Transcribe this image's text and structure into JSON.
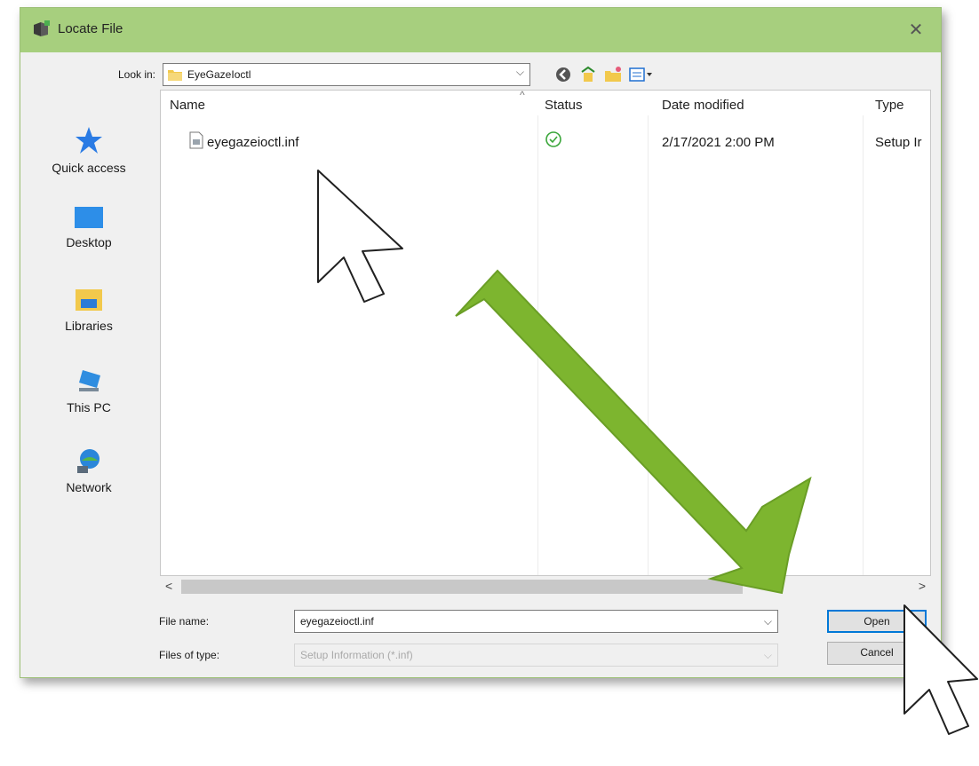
{
  "window": {
    "title": "Locate File",
    "close_glyph": "✕"
  },
  "look_in": {
    "label": "Look in:",
    "value": "EyeGazeIoctl"
  },
  "toolbar": {
    "icons": [
      "back-icon",
      "up-folder-icon",
      "new-folder-icon",
      "view-menu-icon"
    ]
  },
  "places": [
    {
      "label": "Quick access",
      "icon": "quick-access-icon"
    },
    {
      "label": "Desktop",
      "icon": "desktop-icon"
    },
    {
      "label": "Libraries",
      "icon": "libraries-icon"
    },
    {
      "label": "This PC",
      "icon": "this-pc-icon"
    },
    {
      "label": "Network",
      "icon": "network-icon"
    }
  ],
  "file_list": {
    "columns": [
      "Name",
      "Status",
      "Date modified",
      "Type"
    ],
    "sort_glyph": "^",
    "rows": [
      {
        "name": "eyegazeioctl.inf",
        "status": "synced",
        "date": "2/17/2021 2:00 PM",
        "type": "Setup Ir"
      }
    ]
  },
  "scrollbar": {
    "left_glyph": "<",
    "right_glyph": ">"
  },
  "file_name": {
    "label": "File name:",
    "value": "eyegazeioctl.inf"
  },
  "file_type": {
    "label": "Files of type:",
    "value": "Setup Information (*.inf)"
  },
  "buttons": {
    "open": "Open",
    "cancel": "Cancel"
  },
  "colors": {
    "titlebar": "#a7cf7e",
    "arrow_green": "#7db52f",
    "focus_blue": "#0078d7"
  }
}
